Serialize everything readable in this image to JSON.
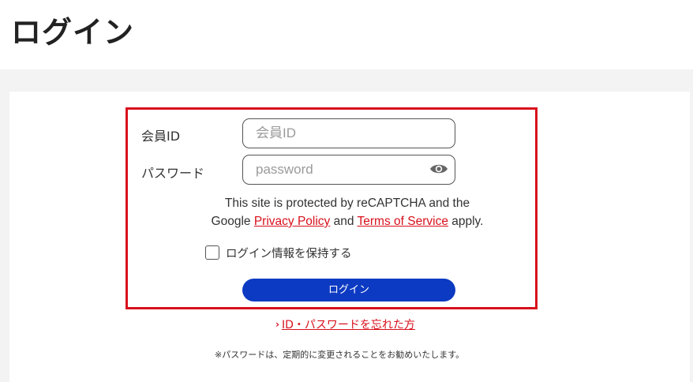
{
  "page": {
    "title": "ログイン"
  },
  "form": {
    "member_id_label": "会員ID",
    "member_id_placeholder": "会員ID",
    "member_id_value": "",
    "password_label": "パスワード",
    "password_placeholder": "password",
    "password_value": "",
    "password_toggle_icon": "eye-icon",
    "recaptcha_line1": "This site is protected by reCAPTCHA and the",
    "recaptcha_prefix": "Google",
    "privacy_policy_label": "Privacy Policy",
    "recaptcha_and": "and",
    "terms_label": "Terms of Service",
    "recaptcha_suffix": "apply.",
    "remember_label": "ログイン情報を保持する",
    "remember_checked": false,
    "login_button_label": "ログイン"
  },
  "links": {
    "forgot_chevron": "›",
    "forgot_label": "ID・パスワードを忘れた方"
  },
  "notice": "※パスワードは、定期的に変更されることをお勧めいたします。",
  "colors": {
    "accent_red": "#d8101c",
    "button_blue": "#0d3ac2",
    "background_gray": "#f3f3f3"
  }
}
